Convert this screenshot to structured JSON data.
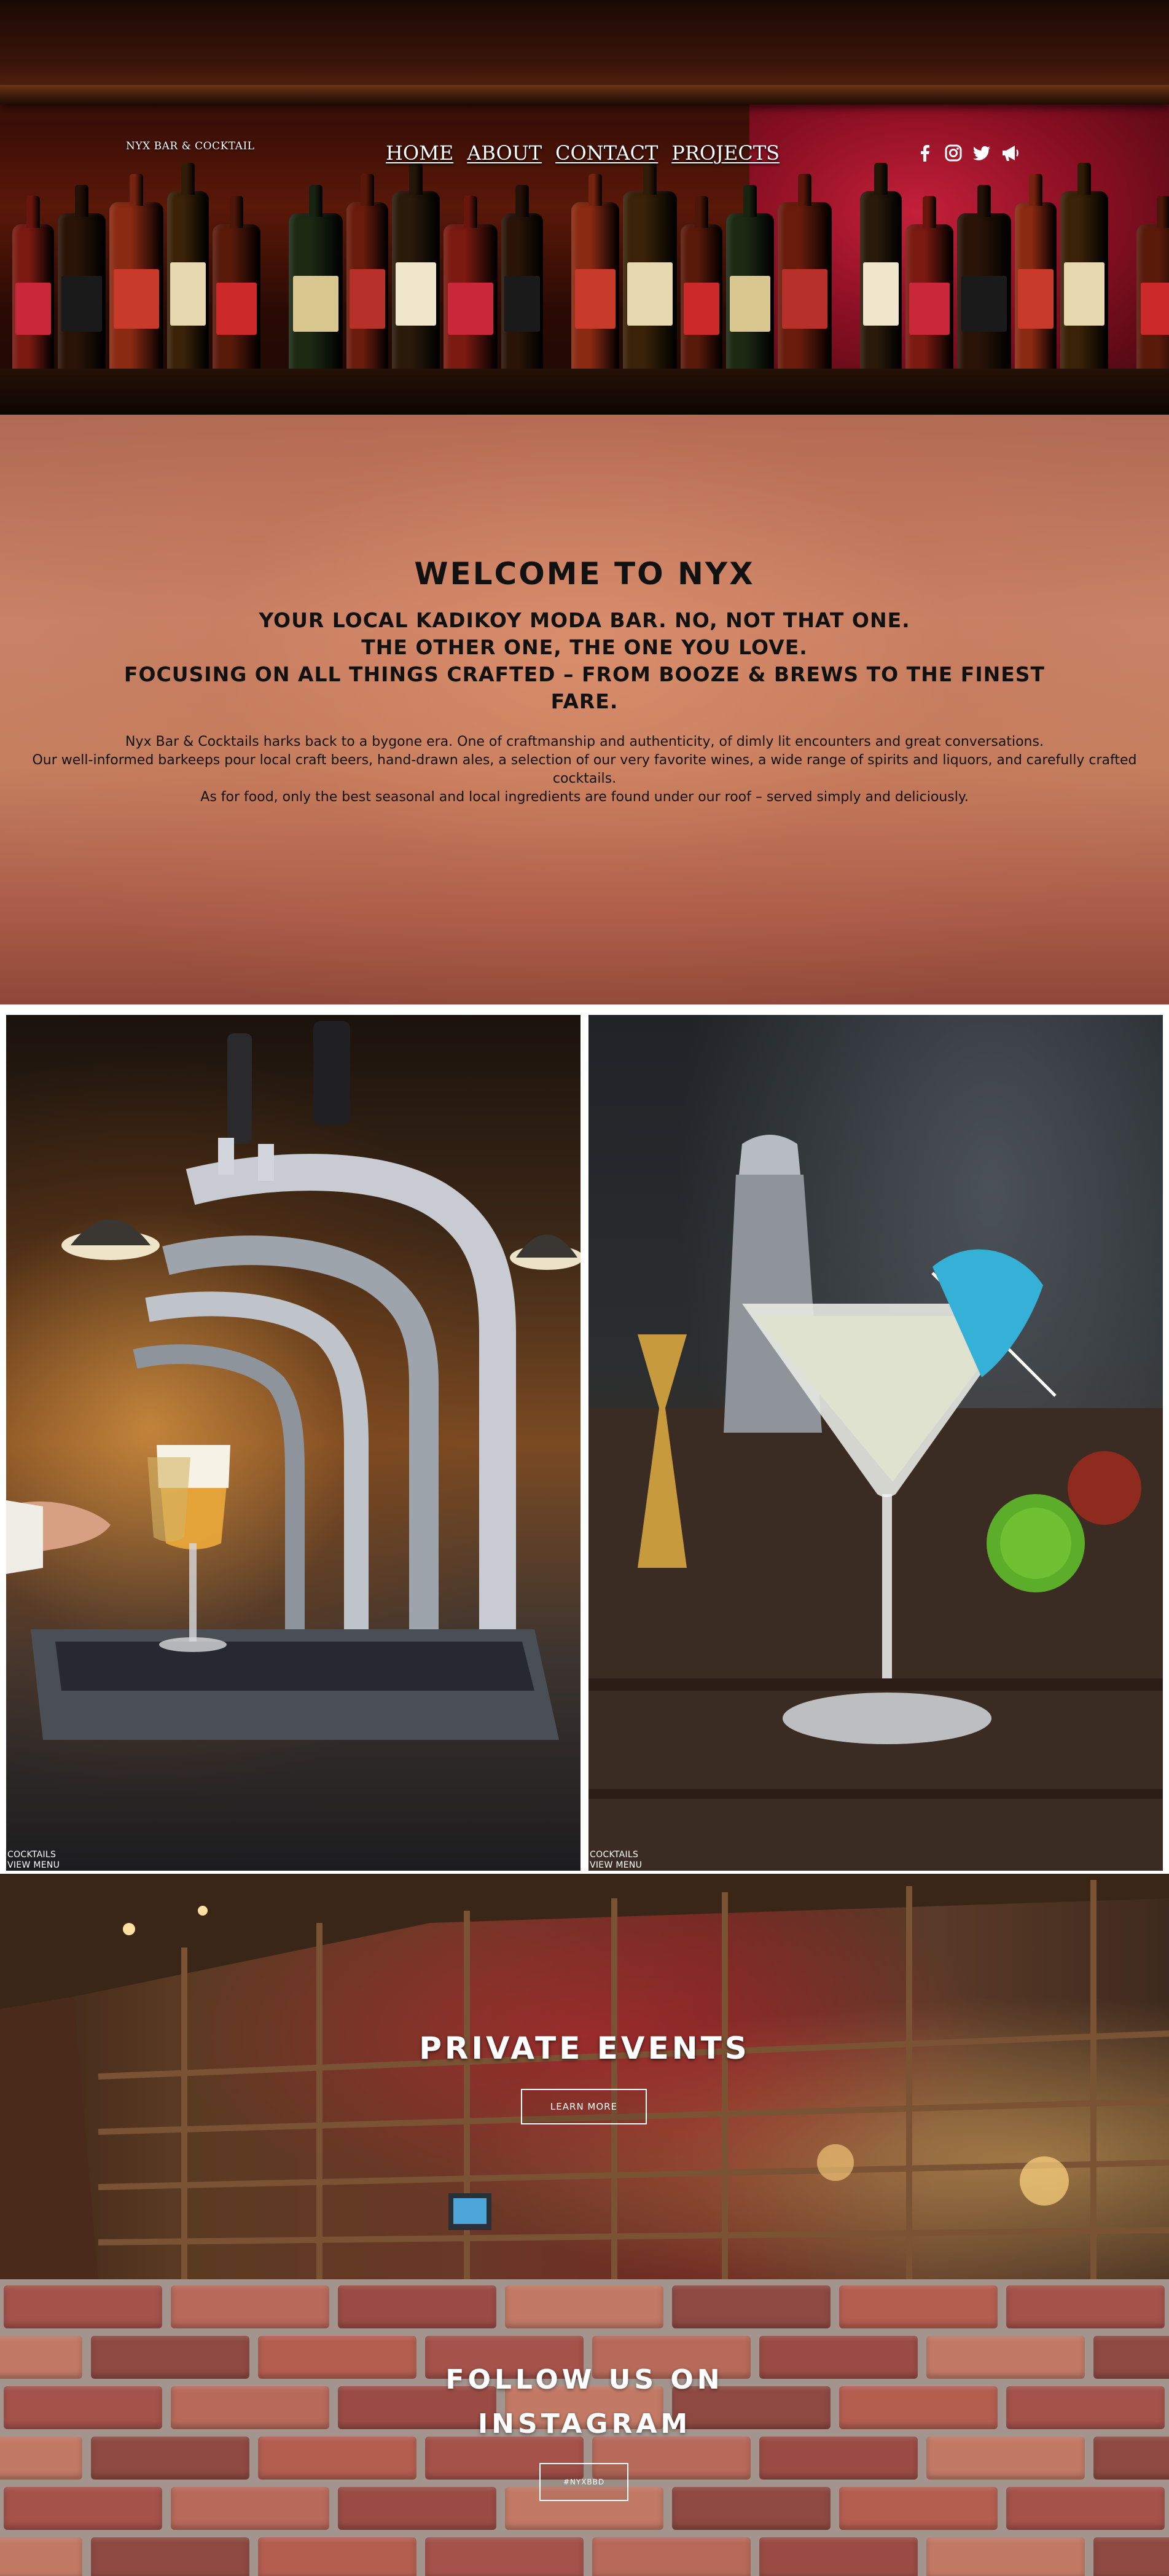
{
  "header": {
    "brand": "NYX BAR & COCKTAIL",
    "nav": [
      {
        "label": "HOME"
      },
      {
        "label": "ABOUT"
      },
      {
        "label": "CONTACT"
      },
      {
        "label": "PROJECTS"
      }
    ],
    "social_icons": [
      "facebook-icon",
      "instagram-icon",
      "twitter-icon",
      "megaphone-icon"
    ]
  },
  "welcome": {
    "title": "WELCOME TO NYX",
    "subtitle_lines": [
      "YOUR LOCAL KADIKOY MODA BAR. NO, NOT THAT ONE.",
      "THE OTHER ONE, THE ONE YOU LOVE.",
      "FOCUSING ON ALL THINGS CRAFTED – FROM BOOZE & BREWS TO THE FINEST FARE."
    ],
    "paragraphs": [
      "Nyx Bar & Cocktails harks back to a bygone era. One of craftmanship and authenticity, of dimly lit encounters and great conversations.",
      "Our well-informed barkeeps pour local craft beers, hand-drawn ales, a selection of our very favorite wines, a wide range of spirits and liquors, and carefully crafted cocktails.",
      "As for food, only the best seasonal and local ingredients are found under our roof – served simply and deliciously."
    ]
  },
  "gallery": [
    {
      "category": "COCKTAILS",
      "link": "VIEW MENU"
    },
    {
      "category": "COCKTAILS",
      "link": "VIEW MENU"
    }
  ],
  "events": {
    "title": "PRIVATE EVENTS",
    "button": "LEARN MORE"
  },
  "instagram": {
    "title_line1": "FOLLOW US ON",
    "title_line2": "INSTAGRAM",
    "button": "#NYXBBD"
  },
  "colors": {
    "accent_white": "#ffffff",
    "text_dark": "#111111",
    "welcome_bg": "#c4805f"
  }
}
